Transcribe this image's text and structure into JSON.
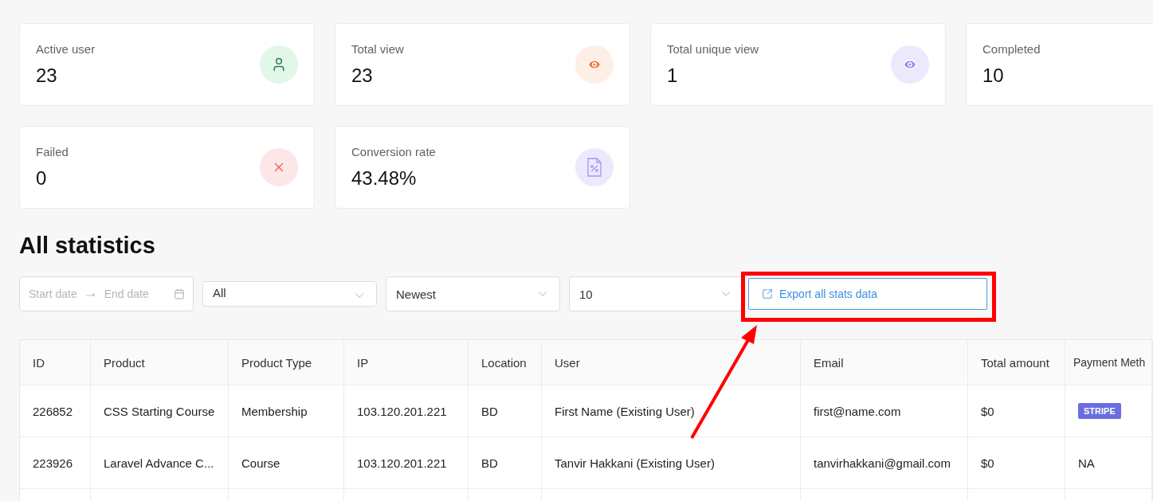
{
  "stats": [
    {
      "label": "Active user",
      "value": "23"
    },
    {
      "label": "Total view",
      "value": "23"
    },
    {
      "label": "Total unique view",
      "value": "1"
    },
    {
      "label": "Completed",
      "value": "10"
    },
    {
      "label": "Failed",
      "value": "0"
    },
    {
      "label": "Conversion rate",
      "value": "43.48%"
    }
  ],
  "section_title": "All statistics",
  "filters": {
    "start_placeholder": "Start date",
    "end_placeholder": "End date",
    "type_select": "All",
    "sort_select": "Newest",
    "page_size_select": "10",
    "export_button": "Export all stats data"
  },
  "table": {
    "columns": [
      "ID",
      "Product",
      "Product Type",
      "IP",
      "Location",
      "User",
      "Email",
      "Total amount",
      "Payment Meth"
    ],
    "rows": [
      {
        "cells": [
          "226852",
          "CSS Starting Course",
          "Membership",
          "103.120.201.221",
          "BD",
          "First Name (Existing User)",
          "first@name.com",
          "$0"
        ],
        "payment": {
          "kind": "badge",
          "text": "STRIPE"
        }
      },
      {
        "cells": [
          "223926",
          "Laravel Advance C...",
          "Course",
          "103.120.201.221",
          "BD",
          "Tanvir Hakkani (Existing User)",
          "tanvirhakkani@gmail.com",
          "$0"
        ],
        "payment": {
          "kind": "text",
          "text": "NA"
        }
      }
    ]
  }
}
